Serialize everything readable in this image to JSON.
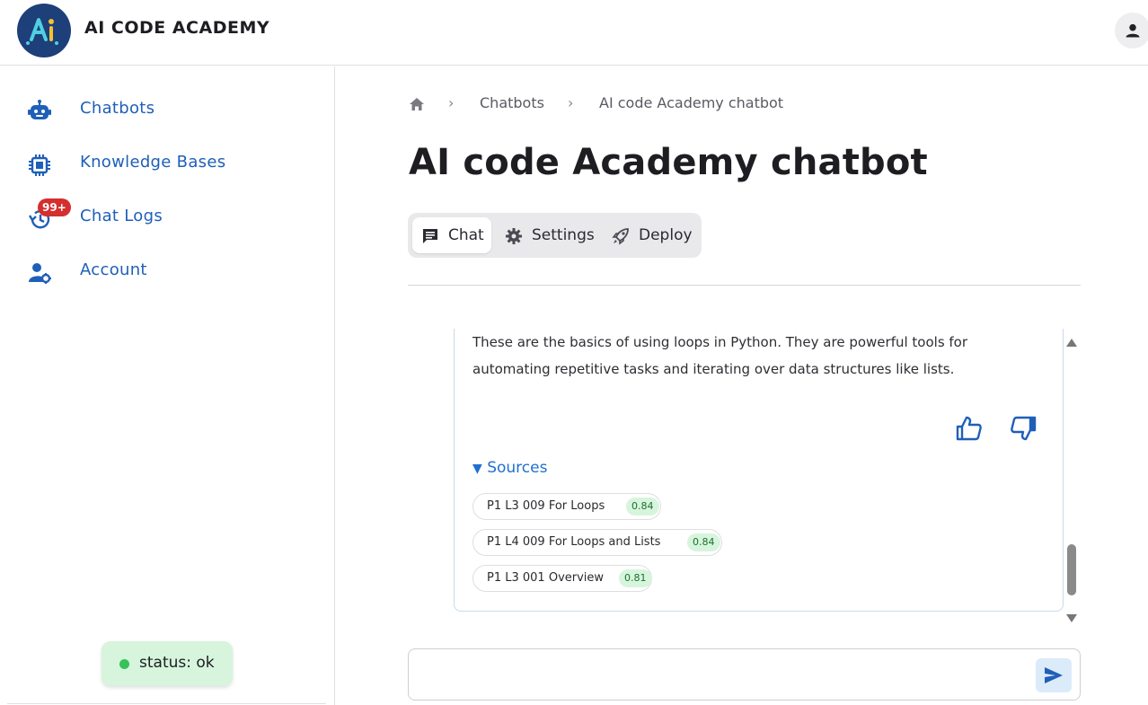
{
  "header": {
    "brand": "AI CODE ACADEMY",
    "logo_icon": "ai-logo-icon",
    "user_icon": "person-icon"
  },
  "sidebar": {
    "items": [
      {
        "label": "Chatbots",
        "icon": "robot-icon"
      },
      {
        "label": "Knowledge Bases",
        "icon": "chip-icon"
      },
      {
        "label": "Chat Logs",
        "icon": "history-icon",
        "badge": "99+"
      },
      {
        "label": "Account",
        "icon": "user-gear-icon"
      }
    ],
    "status": "status: ok",
    "accent": "#1f5fb8"
  },
  "breadcrumb": {
    "home_icon": "home-icon",
    "items": [
      "Chatbots",
      "AI code Academy chatbot"
    ]
  },
  "page_title": "AI code Academy chatbot",
  "tabs": [
    {
      "label": "Chat",
      "icon": "chat-icon",
      "active": true
    },
    {
      "label": "Settings",
      "icon": "gear-icon",
      "active": false
    },
    {
      "label": "Deploy",
      "icon": "rocket-icon",
      "active": false
    }
  ],
  "message": {
    "text": "These are the basics of using loops in Python. They are powerful tools for automating repetitive tasks and iterating over data structures like lists.",
    "feedback_icons": [
      "thumbs-up-icon",
      "thumbs-down-icon"
    ],
    "sources_label": "Sources",
    "sources": [
      {
        "title": "P1 L3 009 For Loops",
        "score": "0.84"
      },
      {
        "title": "P1 L4 009 For Loops and Lists",
        "score": "0.84"
      },
      {
        "title": "P1 L3 001 Overview",
        "score": "0.81"
      }
    ]
  },
  "composer": {
    "value": "",
    "send_icon": "send-icon"
  }
}
